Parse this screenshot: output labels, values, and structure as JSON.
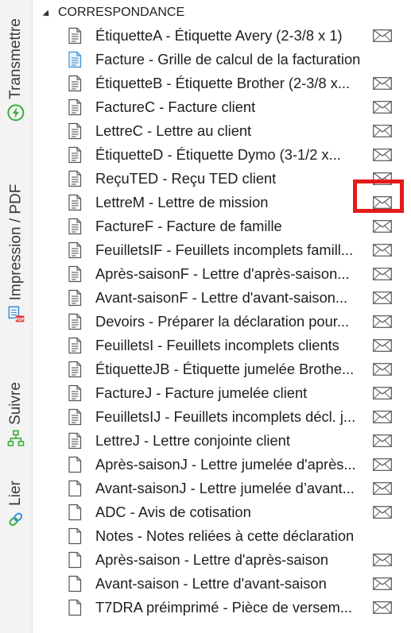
{
  "sidebar": {
    "tabs": [
      {
        "label": "Transmettre",
        "icon": "lightning-icon"
      },
      {
        "label": "Impression / PDF",
        "icon": "printer-pdf-icon"
      },
      {
        "label": "Suivre",
        "icon": "org-chart-icon"
      },
      {
        "label": "Lier",
        "icon": "link-icon"
      }
    ]
  },
  "section": {
    "title": "CORRESPONDANCE",
    "expanded": true
  },
  "items": [
    {
      "label": "ÉtiquetteA - Étiquette Avery (2-3/8 x 1)",
      "icon": "lined",
      "mail": true
    },
    {
      "label": "Facture - Grille de calcul de la facturation",
      "icon": "blue",
      "mail": false
    },
    {
      "label": "ÉtiquetteB - Étiquette Brother (2-3/8 x...",
      "icon": "lined",
      "mail": true
    },
    {
      "label": "FactureC - Facture client",
      "icon": "lined",
      "mail": true
    },
    {
      "label": "LettreC - Lettre au client",
      "icon": "lined",
      "mail": true
    },
    {
      "label": "ÉtiquetteD - Étiquette Dymo (3-1/2 x...",
      "icon": "lined",
      "mail": true
    },
    {
      "label": "ReçuTED - Reçu TED client",
      "icon": "lined",
      "mail": true
    },
    {
      "label": "LettreM - Lettre de mission",
      "icon": "lined",
      "mail": true
    },
    {
      "label": "FactureF - Facture de famille",
      "icon": "lined",
      "mail": true
    },
    {
      "label": "FeuilletsIF - Feuillets incomplets famill...",
      "icon": "lined",
      "mail": true
    },
    {
      "label": "Après-saisonF - Lettre d'après-saison...",
      "icon": "lined",
      "mail": true
    },
    {
      "label": "Avant-saisonF - Lettre d'avant-saison...",
      "icon": "lined",
      "mail": true
    },
    {
      "label": "Devoirs - Préparer la déclaration pour...",
      "icon": "lined",
      "mail": true
    },
    {
      "label": "FeuilletsI - Feuillets incomplets clients",
      "icon": "lined",
      "mail": true
    },
    {
      "label": "ÉtiquetteJB - Étiquette jumelée Brothe...",
      "icon": "lined",
      "mail": true
    },
    {
      "label": "FactureJ - Facture jumelée client",
      "icon": "lined",
      "mail": true
    },
    {
      "label": "FeuilletsIJ - Feuillets incomplets décl. j...",
      "icon": "lined",
      "mail": true
    },
    {
      "label": "LettreJ - Lettre conjointe client",
      "icon": "lined",
      "mail": true
    },
    {
      "label": "Après-saisonJ - Lettre jumelée d'après...",
      "icon": "blank",
      "mail": true
    },
    {
      "label": "Avant-saisonJ - Lettre jumelée d’avant...",
      "icon": "blank",
      "mail": true
    },
    {
      "label": "ADC - Avis de cotisation",
      "icon": "blank",
      "mail": true
    },
    {
      "label": "Notes - Notes reliées à cette déclaration",
      "icon": "blank",
      "mail": false
    },
    {
      "label": "Après-saison - Lettre d'après-saison",
      "icon": "blank",
      "mail": true
    },
    {
      "label": "Avant-saison - Lettre d'avant-saison",
      "icon": "blank",
      "mail": true
    },
    {
      "label": "T7DRA préimprimé - Pièce de versem...",
      "icon": "blank",
      "mail": true
    }
  ],
  "highlighted_row": 7,
  "colors": {
    "highlight": "#e51a1a",
    "icon_stroke": "#555555",
    "icon_blue": "#3a8fd6",
    "lightning": "#3cae3c",
    "printer": "#3a8fd6",
    "pdf": "#e53935"
  }
}
